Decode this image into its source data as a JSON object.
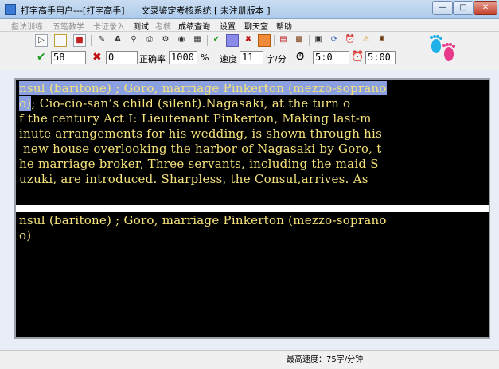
{
  "window": {
    "title": "打字高手用户---[打字高手]      文录鉴定考核系统 [ 未注册版本 ]",
    "minimize_glyph": "—",
    "maximize_glyph": "□",
    "close_glyph": "✕"
  },
  "menu": [
    {
      "label": "指法训练",
      "enabled": false
    },
    {
      "label": "五笔教学",
      "enabled": false
    },
    {
      "label": "卡证录入",
      "enabled": false
    },
    {
      "label": "测试",
      "enabled": true
    },
    {
      "label": "考核",
      "enabled": false
    },
    {
      "label": "成绩查询",
      "enabled": true
    },
    {
      "label": "设置",
      "enabled": true
    },
    {
      "label": "聊天室",
      "enabled": true
    },
    {
      "label": "帮助",
      "enabled": true
    }
  ],
  "toolbar_icons": [
    "play-icon",
    "square-icon",
    "stop-icon",
    "tool-icon",
    "font-icon",
    "search-icon",
    "print-icon",
    "gear-icon",
    "disc-icon",
    "calendar-icon",
    "check-icon",
    "blue-color-icon",
    "cross-icon",
    "orange-color-icon",
    "chart-icon",
    "grid-icon",
    "book-icon",
    "refresh-icon",
    "alarm-icon",
    "warning-icon",
    "figure-icon"
  ],
  "stats": {
    "correct_count": "58",
    "error_count": "0",
    "accuracy_label": "正确率",
    "accuracy_value": "1000",
    "accuracy_unit": "%",
    "speed_label": "速度",
    "speed_value": "11",
    "speed_unit": "字/分",
    "elapsed_time": "5:0",
    "limit_time": "5:00"
  },
  "source_text": {
    "line1_highlight": "nsul (baritone) ; Goro, marriage Pinkerton (mezzo-soprano",
    "line2_highlight": "o)",
    "line2_rest": "; Cio-cio-san’s child (silent).Nagasaki, at the turn o",
    "line3": "f the century Act I: Lieutenant Pinkerton, Making last-m",
    "line4": "inute arrangements for his wedding, is shown through his",
    "line5": " new house overlooking the harbor of Nagasaki by Goro, t",
    "line6": "he marriage broker, Three servants, including the maid S",
    "line7": "uzuki, are introduced. Sharpless, the Consul,arrives. As"
  },
  "typed_text": {
    "line1": "nsul (baritone) ; Goro, marriage Pinkerton (mezzo-soprano",
    "line2": "o)"
  },
  "status": {
    "max_speed": "最高速度：75字/分钟"
  }
}
